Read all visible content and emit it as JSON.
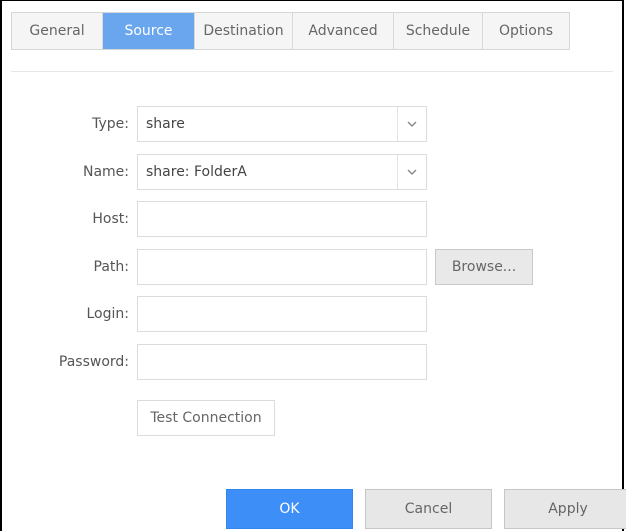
{
  "tabs": [
    {
      "label": "General",
      "active": false
    },
    {
      "label": "Source",
      "active": true
    },
    {
      "label": "Destination",
      "active": false
    },
    {
      "label": "Advanced",
      "active": false
    },
    {
      "label": "Schedule",
      "active": false
    },
    {
      "label": "Options",
      "active": false
    }
  ],
  "form": {
    "type": {
      "label": "Type:",
      "value": "share"
    },
    "name": {
      "label": "Name:",
      "value": "share: FolderA"
    },
    "host": {
      "label": "Host:",
      "value": ""
    },
    "path": {
      "label": "Path:",
      "value": ""
    },
    "login": {
      "label": "Login:",
      "value": ""
    },
    "password": {
      "label": "Password:",
      "value": ""
    },
    "browse_label": "Browse...",
    "test_connection_label": "Test Connection"
  },
  "footer": {
    "ok_label": "OK",
    "cancel_label": "Cancel",
    "apply_label": "Apply"
  },
  "colors": {
    "active_tab": "#6aa6ee",
    "primary_button": "#3d8ef6"
  },
  "icons": {
    "dropdown": "chevron-down-icon"
  }
}
